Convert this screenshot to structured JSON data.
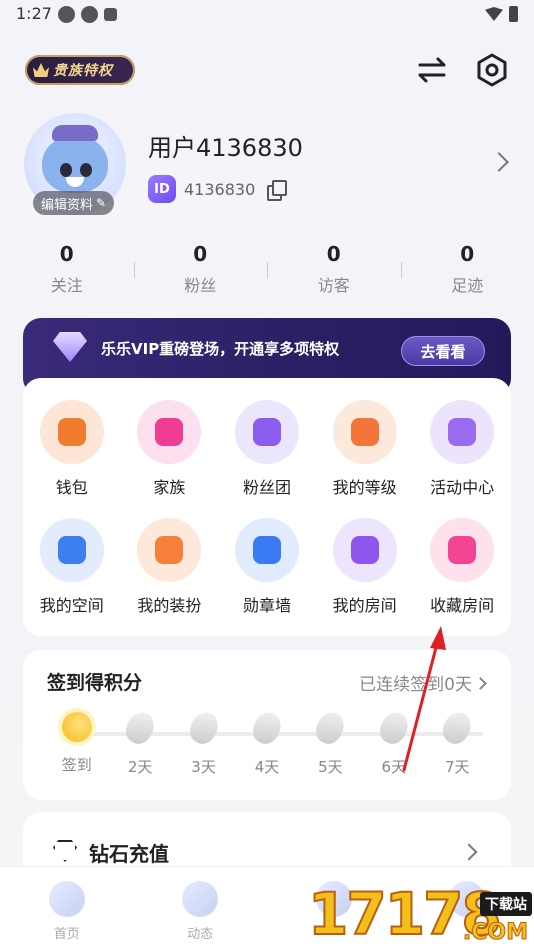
{
  "status_bar": {
    "time": "1:27"
  },
  "header": {
    "noble_badge": "贵族特权",
    "switch_icon": "switch-arrows-icon",
    "settings_icon": "settings-hex-icon"
  },
  "profile": {
    "username": "用户4136830",
    "id_badge": "ID",
    "user_id": "4136830",
    "edit_label": "编辑资料"
  },
  "stats": [
    {
      "value": "0",
      "label": "关注"
    },
    {
      "value": "0",
      "label": "粉丝"
    },
    {
      "value": "0",
      "label": "访客"
    },
    {
      "value": "0",
      "label": "足迹"
    }
  ],
  "vip": {
    "text": "乐乐VIP重磅登场，开通享多项特权",
    "button": "去看看"
  },
  "features": [
    {
      "label": "钱包",
      "icon": "wallet-icon",
      "bg": "#fde6d6",
      "fg": "#f07a2e"
    },
    {
      "label": "家族",
      "icon": "family-icon",
      "bg": "#fde0ef",
      "fg": "#ee3d93"
    },
    {
      "label": "粉丝团",
      "icon": "fan-club-icon",
      "bg": "#ece6fd",
      "fg": "#8a5cf0"
    },
    {
      "label": "我的等级",
      "icon": "level-icon",
      "bg": "#fde8dc",
      "fg": "#f2763a"
    },
    {
      "label": "活动中心",
      "icon": "activity-gift-icon",
      "bg": "#ece4fd",
      "fg": "#9a6af0"
    },
    {
      "label": "我的空间",
      "icon": "planet-icon",
      "bg": "#e2ecfd",
      "fg": "#3d7ef0"
    },
    {
      "label": "我的装扮",
      "icon": "outfit-icon",
      "bg": "#fde8dc",
      "fg": "#f5803c"
    },
    {
      "label": "勋章墙",
      "icon": "medal-icon",
      "bg": "#e0ebfd",
      "fg": "#3a7af2"
    },
    {
      "label": "我的房间",
      "icon": "room-icon",
      "bg": "#ede4fd",
      "fg": "#8e56ee"
    },
    {
      "label": "收藏房间",
      "icon": "favorite-room-icon",
      "bg": "#fde2ee",
      "fg": "#f24594"
    }
  ],
  "sign_in": {
    "title": "签到得积分",
    "streak": "已连续签到0天",
    "days": [
      "签到",
      "2天",
      "3天",
      "4天",
      "5天",
      "6天",
      "7天"
    ]
  },
  "diamond": {
    "label": "钻石充值"
  },
  "tabs": [
    {
      "label": "首页",
      "icon": "music-note-icon"
    },
    {
      "label": "动态",
      "icon": "moment-icon"
    },
    {
      "label": "",
      "icon": "message-icon"
    },
    {
      "label": "",
      "icon": "mine-icon"
    }
  ],
  "watermark": {
    "number": "17178",
    "tag": "下载站",
    "suffix": ".COM"
  },
  "colors": {
    "accent": "#6d4cf0",
    "vip_bg": "#2c2166",
    "annotation_arrow": "#e02020"
  }
}
